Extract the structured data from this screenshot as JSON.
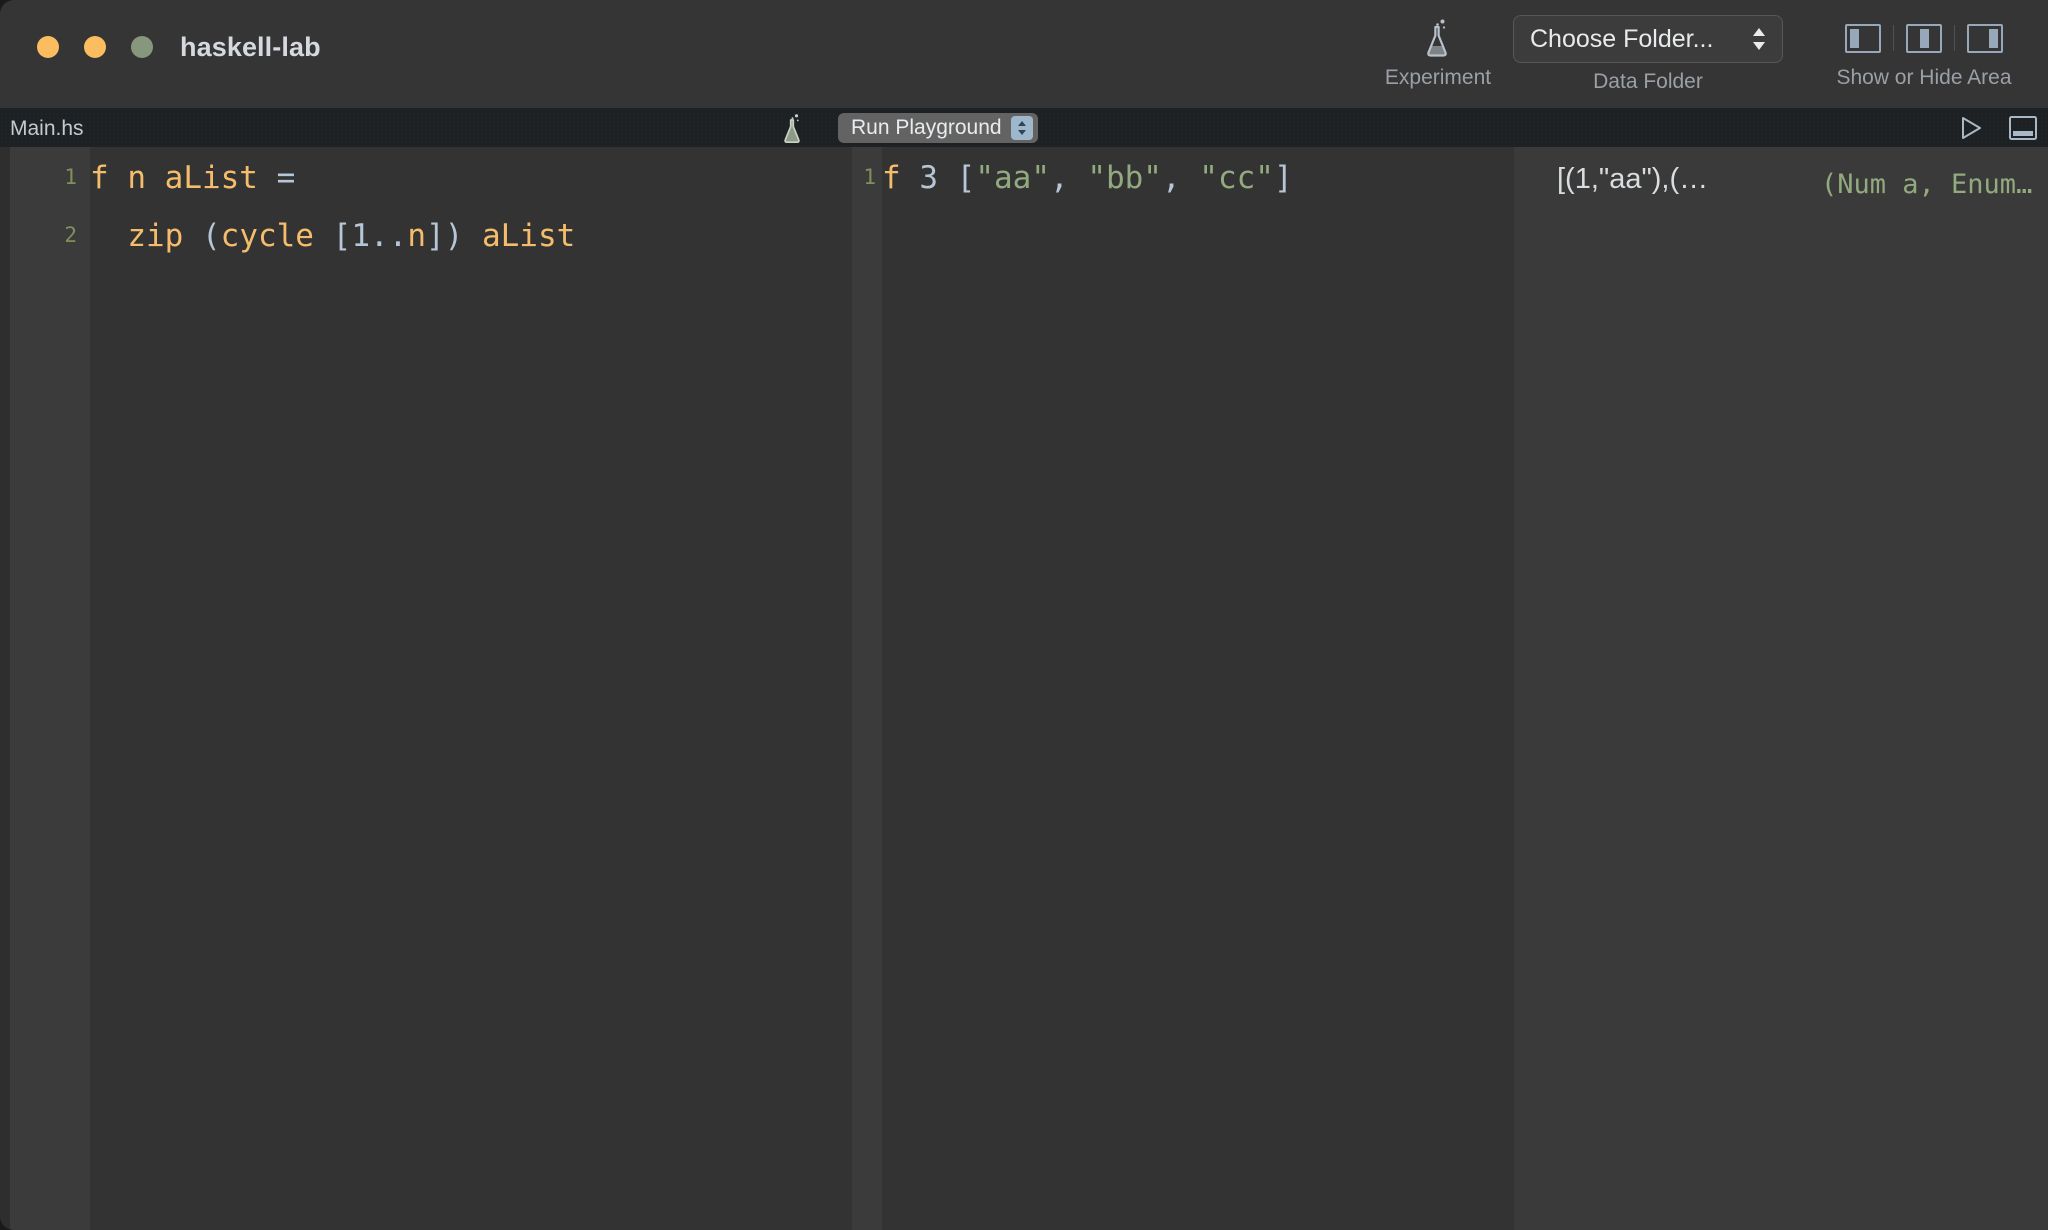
{
  "window": {
    "title": "haskell-lab",
    "traffic_lights": [
      {
        "name": "close",
        "color": "#fcbd60"
      },
      {
        "name": "minimize",
        "color": "#fcbd60"
      },
      {
        "name": "zoom",
        "color": "#87977d"
      }
    ]
  },
  "toolbar": {
    "experiment": {
      "icon": "flask-icon",
      "label": "Experiment"
    },
    "data_folder": {
      "label": "Data Folder",
      "popup_value": "Choose Folder...",
      "popup_icon": "chevron-up-down-icon"
    },
    "show_hide_area": {
      "label": "Show or Hide Area",
      "buttons": [
        {
          "name": "toggle-left-panel-icon",
          "state": "active"
        },
        {
          "name": "toggle-center-panel-icon",
          "state": "inactive"
        },
        {
          "name": "toggle-right-panel-icon",
          "state": "inactive"
        }
      ]
    }
  },
  "tabbar": {
    "filename": "Main.hs",
    "flask_icon": "flask-icon",
    "run_playground_label": "Run Playground",
    "run_playground_stepper_icon": "chevron-up-down-icon",
    "right_icons": [
      {
        "name": "run-triangle-icon"
      },
      {
        "name": "toggle-bottom-panel-icon"
      }
    ]
  },
  "editor": {
    "line_numbers": [
      "1",
      "2"
    ],
    "lines": [
      [
        {
          "text": "f n aList ",
          "cls": "tok-id"
        },
        {
          "text": "=",
          "cls": "tok-op"
        }
      ],
      [
        {
          "text": "  zip ",
          "cls": "tok-id"
        },
        {
          "text": "(",
          "cls": "tok-op"
        },
        {
          "text": "cycle ",
          "cls": "tok-id"
        },
        {
          "text": "[",
          "cls": "tok-op"
        },
        {
          "text": "1",
          "cls": "tok-num"
        },
        {
          "text": "..",
          "cls": "tok-op"
        },
        {
          "text": "n",
          "cls": "tok-id"
        },
        {
          "text": "])",
          "cls": "tok-op"
        },
        {
          "text": " aList",
          "cls": "tok-id"
        }
      ]
    ]
  },
  "playground": {
    "line_numbers": [
      "1"
    ],
    "lines": [
      [
        {
          "text": "f ",
          "cls": "tok-id"
        },
        {
          "text": "3",
          "cls": "tok-num"
        },
        {
          "text": " [",
          "cls": "tok-op"
        },
        {
          "text": "\"aa\"",
          "cls": "tok-str"
        },
        {
          "text": ", ",
          "cls": "tok-op"
        },
        {
          "text": "\"bb\"",
          "cls": "tok-str"
        },
        {
          "text": ", ",
          "cls": "tok-op"
        },
        {
          "text": "\"cc\"",
          "cls": "tok-str"
        },
        {
          "text": "]",
          "cls": "tok-op"
        }
      ]
    ]
  },
  "results": {
    "value": "[(1,\"aa\"),(…",
    "type": "(Num a, Enum…"
  },
  "colors": {
    "window_bg": "#333333",
    "titlebar_bg": "#353535",
    "tabbar_bg": "#1e2123",
    "gutter_bg": "#3b3b3b",
    "results_bg": "#3a3a3a",
    "identifier": "#f5bd6b",
    "operator": "#b6c6d6",
    "string": "#93a97e",
    "linenumber": "#8ba05f",
    "panel_icon": "#97a8bb",
    "stepper": "#9fb7cc"
  }
}
